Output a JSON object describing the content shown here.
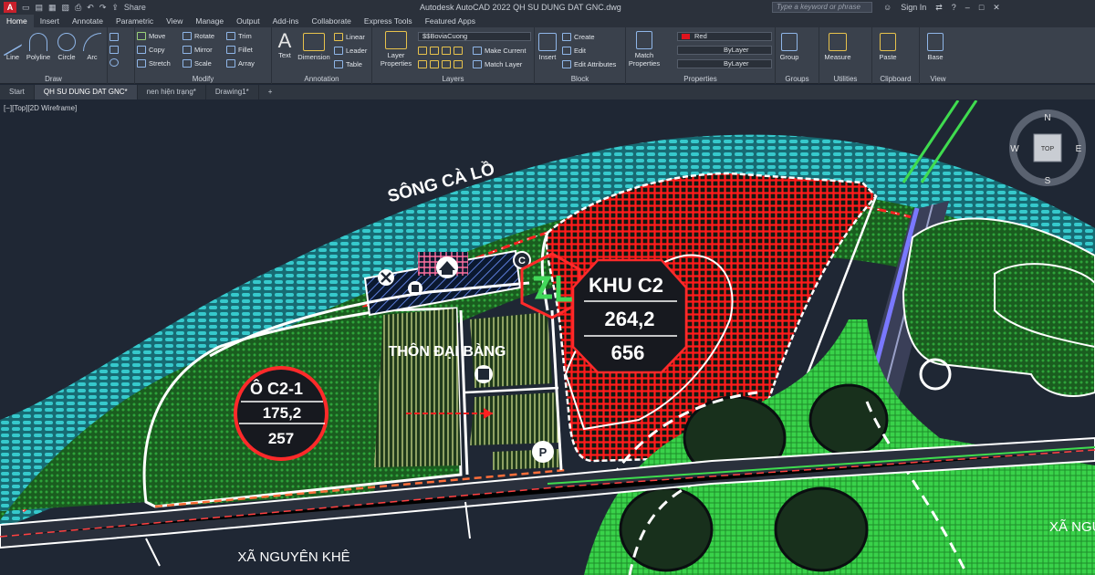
{
  "titlebar": {
    "logo": "A",
    "share_label": "Share",
    "title": "Autodesk AutoCAD 2022   QH SU DUNG DAT GNC.dwg",
    "search_placeholder": "Type a keyword or phrase",
    "signin_label": "Sign In"
  },
  "ribbon_tabs": [
    "Home",
    "Insert",
    "Annotate",
    "Parametric",
    "View",
    "Manage",
    "Output",
    "Add-ins",
    "Collaborate",
    "Express Tools",
    "Featured Apps"
  ],
  "ribbon": {
    "draw": {
      "title": "Draw",
      "line": "Line",
      "polyline": "Polyline",
      "circle": "Circle",
      "arc": "Arc"
    },
    "modify": {
      "title": "Modify",
      "move": "Move",
      "rotate": "Rotate",
      "trim": "Trim",
      "copy": "Copy",
      "mirror": "Mirror",
      "fillet": "Fillet",
      "stretch": "Stretch",
      "scale": "Scale",
      "array": "Array"
    },
    "annotation": {
      "title": "Annotation",
      "text": "Text",
      "dimension": "Dimension",
      "linear": "Linear",
      "leader": "Leader",
      "table": "Table"
    },
    "layers": {
      "title": "Layers",
      "layer_properties": "Layer Properties",
      "current_layer": "$$BoviaCuong",
      "make_current": "Make Current",
      "match_layer": "Match Layer"
    },
    "block": {
      "title": "Block",
      "insert": "Insert",
      "create": "Create",
      "edit": "Edit",
      "edit_attributes": "Edit Attributes"
    },
    "properties": {
      "title": "Properties",
      "match": "Match Properties",
      "color": "Red",
      "linetype": "ByLayer",
      "lineweight": "ByLayer"
    },
    "groups": {
      "title": "Groups",
      "group": "Group"
    },
    "utilities": {
      "title": "Utilities",
      "measure": "Measure"
    },
    "clipboard": {
      "title": "Clipboard",
      "paste": "Paste"
    },
    "view": {
      "title": "View",
      "base": "Base"
    }
  },
  "doc_tabs": [
    "Start",
    "QH SU DUNG DAT GNC*",
    "nen hiện trạng*",
    "Drawing1*"
  ],
  "viewport_label": "[−][Top][2D Wireframe]",
  "viewcube": {
    "n": "N",
    "s": "S",
    "e": "E",
    "w": "W",
    "top": "TOP"
  },
  "map": {
    "river": "SÔNG CÀ LỒ",
    "village": "THÔN ĐẠI BÀNG",
    "commune_left": "XÃ NGUYÊN KHÊ",
    "commune_right": "XÃ NGU",
    "zone_c2": {
      "name": "KHU C2",
      "area": "264,2",
      "pop": "656"
    },
    "zone_c21": {
      "name": "Ô C2-1",
      "area": "175,2",
      "pop": "257"
    },
    "icons": {
      "c": "C",
      "p": "P"
    }
  },
  "colors": {
    "accent": "#0f8ec9",
    "red_zone": "#e0141e",
    "green_zone": "#1f8f2a",
    "teal": "#34c7c9",
    "background": "#1f2734"
  }
}
